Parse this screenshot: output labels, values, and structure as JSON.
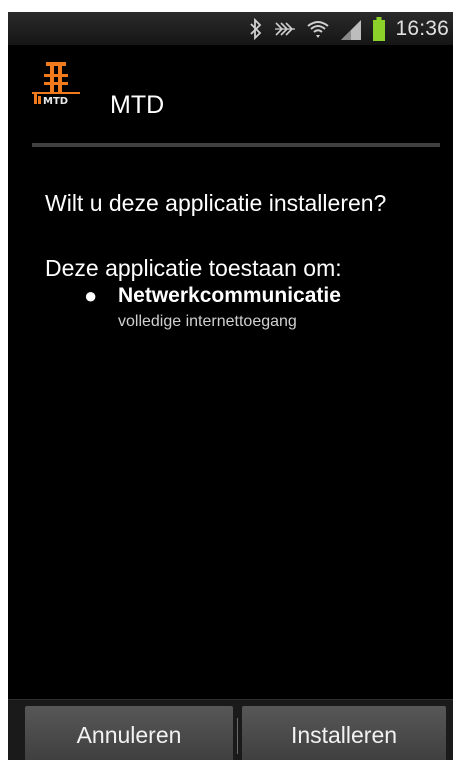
{
  "status_bar": {
    "time": "16:36",
    "icons": [
      "bluetooth-icon",
      "nfc-icon",
      "wifi-icon",
      "signal-icon",
      "battery-icon"
    ],
    "battery_color": "#8bd12a"
  },
  "dialog": {
    "app_name": "MTD",
    "icon_text": "MTD",
    "question": "Wilt u deze applicatie installeren?",
    "permissions_heading": "Deze applicatie toestaan om:",
    "permissions": [
      {
        "bullet": "●",
        "title": "Netwerkcommunicatie",
        "description": "volledige internettoegang"
      }
    ]
  },
  "buttons": {
    "cancel_label": "Annuleren",
    "install_label": "Installeren"
  },
  "colors": {
    "background": "#000000",
    "text": "#ffffff",
    "icon_orange": "#f07a1e",
    "button": "#4a4a4a"
  }
}
